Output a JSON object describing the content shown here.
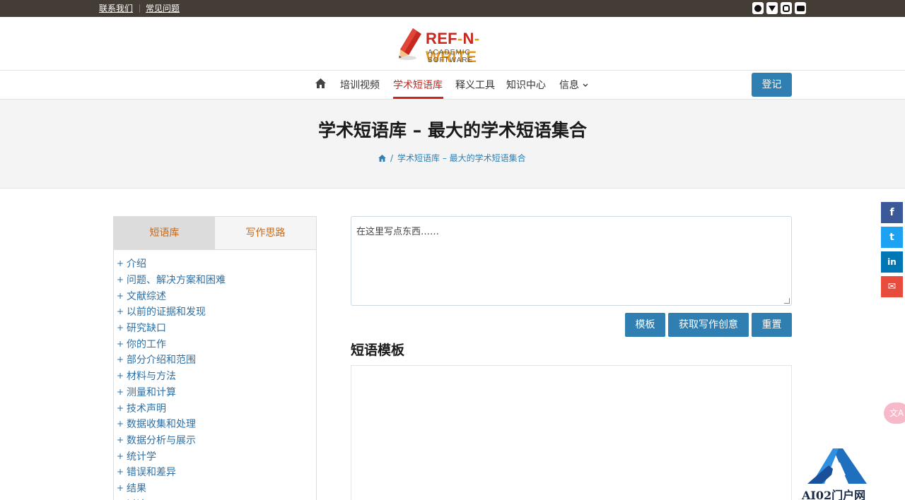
{
  "topbar": {
    "links": [
      "联系我们",
      "常见问题"
    ],
    "social_icons": [
      "facebook-icon",
      "twitter-icon",
      "instagram-icon",
      "youtube-icon"
    ]
  },
  "logo": {
    "brand_a": "REF",
    "brand_dash1": "-",
    "brand_b": "N",
    "brand_dash2": "-",
    "brand_c": "WRITE",
    "tagline": "ACADEMIC SOFTWARE"
  },
  "nav": {
    "items": [
      "培训视频",
      "学术短语库",
      "释义工具",
      "知识中心",
      "信息"
    ],
    "login": "登记",
    "active_color": "#c7281f"
  },
  "page": {
    "title": "学术短语库 – 最大的学术短语集合",
    "breadcrumb": "学术短语库 – 最大的学术短语集合"
  },
  "sidebar": {
    "tabs": [
      "短语库",
      "写作思路"
    ],
    "items": [
      "介绍",
      "问题、解决方案和困难",
      "文献综述",
      "以前的证据和发现",
      "研究缺口",
      "你的工作",
      "部分介绍和范围",
      "材料与方法",
      "测量和计算",
      "技术声明",
      "数据收集和处理",
      "数据分析与展示",
      "统计学",
      "错误和差异",
      "结果",
      "讨论"
    ]
  },
  "editor": {
    "placeholder": "在这里写点东西……"
  },
  "buttons": {
    "template": "模板",
    "ideas": "获取写作创意",
    "reset": "重置"
  },
  "section": {
    "heading": "短语模板"
  },
  "share": {
    "facebook": "f",
    "twitter": "t",
    "linkedin": "in",
    "email": "✉"
  },
  "translate": {
    "label": "文A"
  },
  "watermark": {
    "text": "AI02门户网"
  },
  "colors": {
    "primary": "#2f7fb3",
    "accent": "#c7281f",
    "topbar": "#443d35"
  }
}
